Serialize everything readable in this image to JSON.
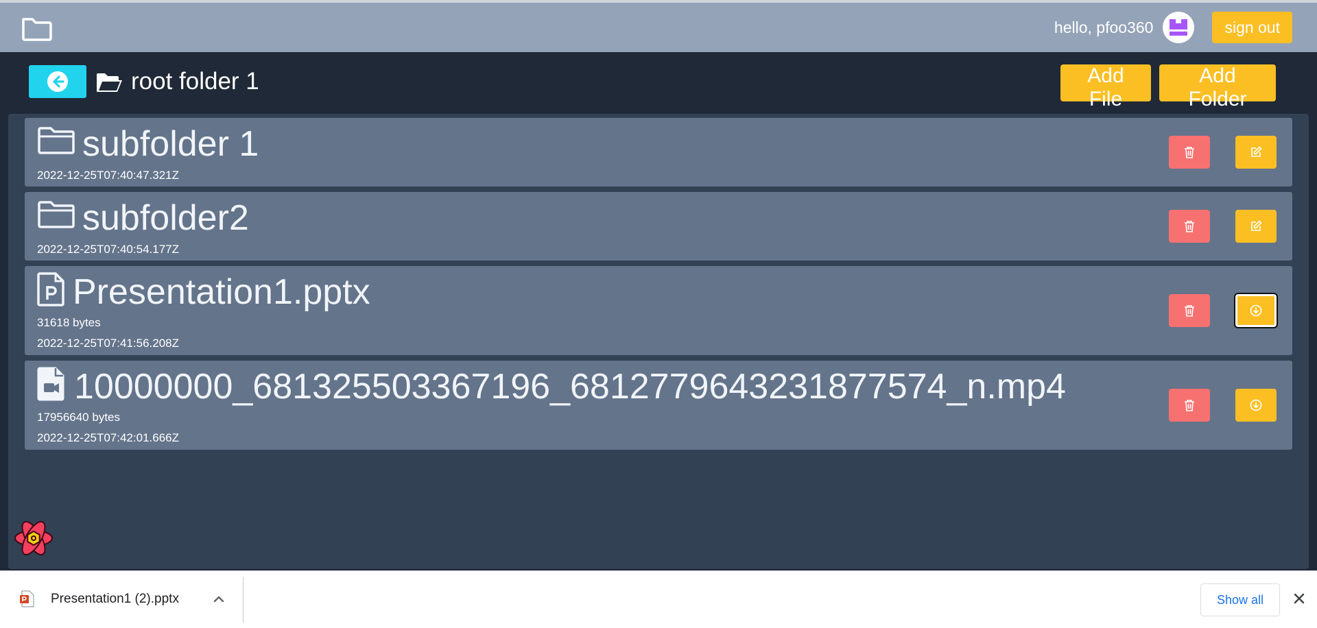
{
  "user": {
    "greeting": "hello, pfoo360"
  },
  "nav": {
    "signout_label": "sign out"
  },
  "folder": {
    "title": "root folder 1"
  },
  "actions": {
    "add_file_label": "Add File",
    "add_folder_label": "Add Folder"
  },
  "items": [
    {
      "type": "folder",
      "name": "subfolder 1",
      "created": "2022-12-25T07:40:47.321Z",
      "icon": "folder-icon",
      "action_icon": "edit-icon"
    },
    {
      "type": "folder",
      "name": "subfolder2",
      "created": "2022-12-25T07:40:54.177Z",
      "icon": "folder-icon",
      "action_icon": "edit-icon"
    },
    {
      "type": "file",
      "name": "Presentation1.pptx",
      "size": "31618 bytes",
      "created": "2022-12-25T07:41:56.208Z",
      "icon": "powerpoint-file-icon",
      "action_icon": "download-icon"
    },
    {
      "type": "file",
      "name": "10000000_681325503367196_6812779643231877574_n.mp4",
      "size": "17956640 bytes",
      "created": "2022-12-25T07:42:01.666Z",
      "icon": "video-file-icon",
      "action_icon": "download-icon"
    }
  ],
  "downloads": {
    "filename": "Presentation1 (2).pptx",
    "show_all_label": "Show all"
  },
  "colors": {
    "navbar": "#94a3b8",
    "accent_yellow": "#fbbf24",
    "accent_cyan": "#22d3ee",
    "delete_red": "#f87171",
    "row_bg": "#64748b",
    "page_bg": "#1f2937"
  }
}
